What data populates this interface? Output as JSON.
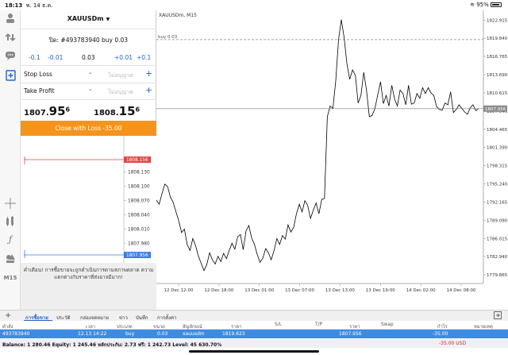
{
  "status_bar": {
    "time": "18:13",
    "date": "พ. 14 ธ.ค.",
    "battery": "95%"
  },
  "left_toolbar": {
    "timeframe_label": "M15"
  },
  "order_panel": {
    "symbol": "XAUUSDm",
    "order_text": "ปิด: #493783940 buy 0.03",
    "volume_steps": [
      "-0.1",
      "-0.01",
      "0.03",
      "+0.01",
      "+0.1"
    ],
    "stop_loss_label": "Stop Loss",
    "take_profit_label": "Take Profit",
    "not_allowed_placeholder": "ไม่อนุญาต",
    "minus_sign": "-",
    "plus_sign": "+",
    "bid_prefix": "1807.",
    "bid_big": "95",
    "bid_sup": "6",
    "ask_prefix": "1808.",
    "ask_big": "15",
    "ask_sup": "6",
    "close_button_label": "Close with Loss -35.00",
    "warning_text": "คำเตือน! การซื้อขายจะถูกดำเนินการตามสภาพตลาด ความแตกต่างกับราคาที่ส่งอาจมีมาก!"
  },
  "mini_chart": {
    "ask_label": "1808.156",
    "bid_label": "1807.956",
    "price_levels": [
      "1808.130",
      "1808.100",
      "1808.070",
      "1808.040",
      "1808.010",
      "1807.980"
    ],
    "ask_color": "#e04848",
    "bid_color": "#3c7ee0"
  },
  "chart_data": {
    "type": "line",
    "title": "XAUUSDm, M15",
    "trade_line_label": "buy 0.03",
    "current_price_label": "1807.956",
    "y_ticks": [
      "1822.915",
      "1819.840",
      "1816.765",
      "1813.690",
      "1810.615",
      "1807.540",
      "1804.465",
      "1801.390",
      "1798.315",
      "1795.240",
      "1792.165",
      "1789.090",
      "1786.015",
      "1782.940",
      "1779.865"
    ],
    "x_ticks": [
      "12 Dec 12:00",
      "12 Dec 18:00",
      "13 Dec 01:00",
      "13 Dec 07:00",
      "13 Dec 13:00",
      "13 Dec 19:00",
      "14 Dec 02:00",
      "14 Dec 08:00"
    ],
    "ylim": [
      1778.4,
      1824.3
    ],
    "trade_price": 1819.623,
    "current_price": 1807.956,
    "values": [
      1792.5,
      1791.8,
      1793.6,
      1795.2,
      1794.8,
      1793.0,
      1792.1,
      1790.5,
      1789.0,
      1787.0,
      1787.6,
      1785.0,
      1784.0,
      1786.0,
      1784.8,
      1783.0,
      1781.8,
      1780.6,
      1781.6,
      1783.6,
      1782.4,
      1781.7,
      1783.0,
      1782.1,
      1783.5,
      1782.6,
      1784.0,
      1785.2,
      1784.2,
      1786.3,
      1786.7,
      1784.1,
      1787.3,
      1788.2,
      1786.1,
      1785.0,
      1783.3,
      1782.0,
      1782.7,
      1784.3,
      1783.6,
      1782.4,
      1784.0,
      1786.0,
      1785.0,
      1786.5,
      1785.9,
      1788.3,
      1787.1,
      1787.9,
      1790.2,
      1791.8,
      1790.5,
      1792.4,
      1791.6,
      1789.4,
      1790.8,
      1792.0,
      1790.2,
      1792.6,
      1792.8,
      1806.6,
      1808.4,
      1808.0,
      1812.5,
      1819.6,
      1823.0,
      1820.0,
      1815.5,
      1812.9,
      1814.5,
      1813.6,
      1808.9,
      1810.2,
      1814.1,
      1811.0,
      1806.6,
      1806.8,
      1808.0,
      1810.3,
      1812.5,
      1808.8,
      1810.2,
      1808.4,
      1811.9,
      1809.6,
      1808.4,
      1811.1,
      1810.5,
      1808.6,
      1811.9,
      1808.7,
      1808.9,
      1810.5,
      1809.7,
      1811.5,
      1810.5,
      1811.5,
      1810.6,
      1810.2,
      1808.3,
      1807.8,
      1807.7,
      1808.9,
      1808.6,
      1810.8,
      1807.3,
      1807.8,
      1808.6,
      1808.0,
      1807.4,
      1807.0,
      1808.1,
      1808.6,
      1807.6,
      1807.96
    ],
    "line_color": "#000000",
    "grid": false
  },
  "tabs": {
    "add_label": "+",
    "items": [
      "การซื้อขาย",
      "ประวัติ",
      "กล่องจดหมาย",
      "ข่าว",
      "บันทึก",
      "การตั้งค่า"
    ]
  },
  "table": {
    "headers": [
      "คำสั่ง",
      "เวลา",
      "ประเภท",
      "ขนาด",
      "สัญลักษณ์",
      "ราคา",
      "S/L",
      "T/P",
      "ราคา",
      "Swap",
      "กำไร",
      "หมายเหตุ"
    ],
    "row": [
      "493783940",
      "12.13 14:22",
      "buy",
      "0.03",
      "xauusdm",
      "1819.623",
      "",
      "",
      "1807.956",
      "",
      "-35.00",
      ""
    ]
  },
  "balance": {
    "text": "Balance: 1 280.46 Equity: 1 245.46 หลักประกัน: 2.73 ฟรี: 1 242.73 Level: 45 630.70%",
    "profit": "-35.00  USD"
  }
}
